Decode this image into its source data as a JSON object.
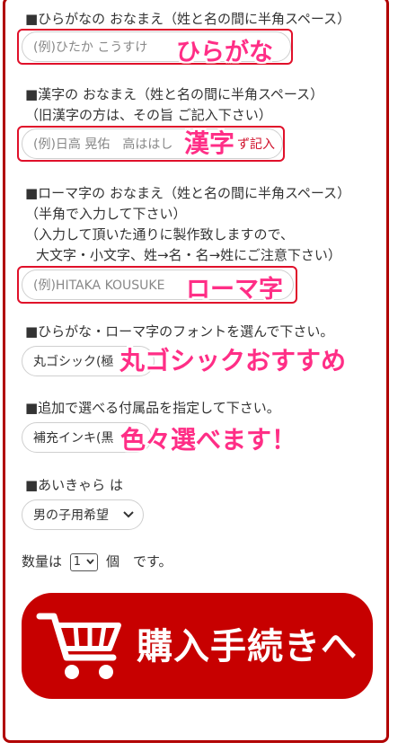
{
  "form": {
    "hiragana_label": "■ひらがなの おなまえ（姓と名の間に半角スペース）",
    "hiragana_placeholder": "(例)ひたか こうすけ",
    "hiragana_callout": "ひらがな",
    "kanji_label_1": "■漢字の おなまえ（姓と名の間に半角スペース）",
    "kanji_label_2": "（旧漢字の方は、その旨 ご記入下さい）",
    "kanji_placeholder": "(例)日高 晃佑　高ははし",
    "kanji_field_suffix": "ず記入",
    "kanji_callout": "漢字",
    "romaji_label_1": "■ローマ字の おなまえ（姓と名の間に半角スペース）",
    "romaji_label_2": "（半角で入力して下さい）",
    "romaji_label_3": "（入力して頂いた通りに製作致しますので、",
    "romaji_label_4": "大文字・小文字、姓→名・名→姓にご注意下さい）",
    "romaji_placeholder": "(例)HITAKA KOUSUKE",
    "romaji_callout": "ローマ字",
    "font_label": "■ひらがな・ローマ字のフォントを選んで下さい。",
    "font_value": "丸ゴシック(極",
    "font_callout": "丸ゴシックおすすめ",
    "accessory_label": "■追加で選べる付属品を指定して下さい。",
    "accessory_value": "補充インキ(黒",
    "accessory_callout": "色々選べます！",
    "aikyara_label": "■あいきゃら は",
    "aikyara_value": "男の子用希望",
    "qty_prefix": "数量は",
    "qty_value": "1",
    "qty_suffix": "個　です。",
    "buy_button": "購入手続きへ"
  },
  "colors": {
    "accent_red": "#c70000",
    "highlight_border": "#e0102a",
    "callout_pink": "#ff2e86"
  }
}
